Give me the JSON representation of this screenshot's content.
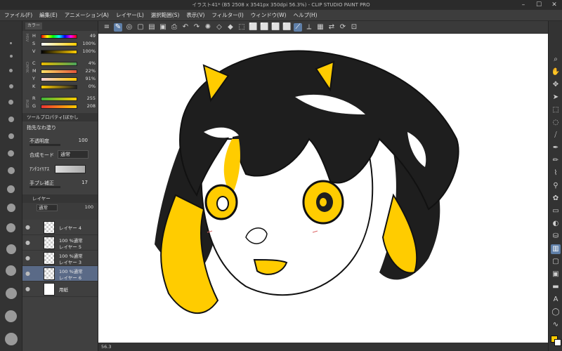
{
  "window": {
    "title": "イラスト41* (B5 2508 x 3541px 350dpi 56.3%) - CLIP STUDIO PAINT PRO"
  },
  "menu": [
    "ファイル(F)",
    "編集(E)",
    "アニメーション(A)",
    "レイヤー(L)",
    "選択範囲(S)",
    "表示(V)",
    "フィルター(I)",
    "ウィンドウ(W)",
    "ヘルプ(H)"
  ],
  "color_panel": {
    "tabs": [
      "カラー"
    ],
    "hsv_label": "HSV",
    "cmyk_label": "CMYK",
    "rgb_label": "RGB",
    "hsv": [
      {
        "label": "H",
        "value": "49"
      },
      {
        "label": "S",
        "value": "100%"
      },
      {
        "label": "V",
        "value": "100%"
      }
    ],
    "cmyk": [
      {
        "label": "C",
        "value": "4%"
      },
      {
        "label": "M",
        "value": "22%"
      },
      {
        "label": "Y",
        "value": "91%"
      },
      {
        "label": "K",
        "value": "0%"
      }
    ],
    "rgb": [
      {
        "label": "R",
        "value": "255"
      },
      {
        "label": "G",
        "value": "208"
      }
    ]
  },
  "tool_property": {
    "tab": "ツールプロパティ[ぼかし",
    "title": "指先なわ塗り",
    "opacity_label": "不透明度",
    "opacity_value": "100",
    "blend_label": "合成モード",
    "blend_value": "通常",
    "antialias_label": "ｱﾝﾁｴｲﾘｱｽ",
    "stabilization_label": "手ブレ補正",
    "stabilization_value": "17"
  },
  "layers": {
    "tab": "レイヤー",
    "blend_mode": "通常",
    "opacity": "100",
    "items": [
      {
        "mode": "",
        "name": "レイヤー 4",
        "selected": false,
        "thumb": "check"
      },
      {
        "mode": "100 %通常",
        "name": "レイヤー 5",
        "selected": false,
        "thumb": "check"
      },
      {
        "mode": "100 %通常",
        "name": "レイヤー 3",
        "selected": false,
        "thumb": "check"
      },
      {
        "mode": "100 %通常",
        "name": "レイヤー 6",
        "selected": true,
        "thumb": "check"
      },
      {
        "mode": "",
        "name": "用紙",
        "selected": false,
        "thumb": "white"
      }
    ]
  },
  "status": {
    "zoom": "56.3"
  },
  "colors": {
    "main": "#ffcc00",
    "sub": "#ffffff",
    "hair": "#1e1e1e"
  }
}
